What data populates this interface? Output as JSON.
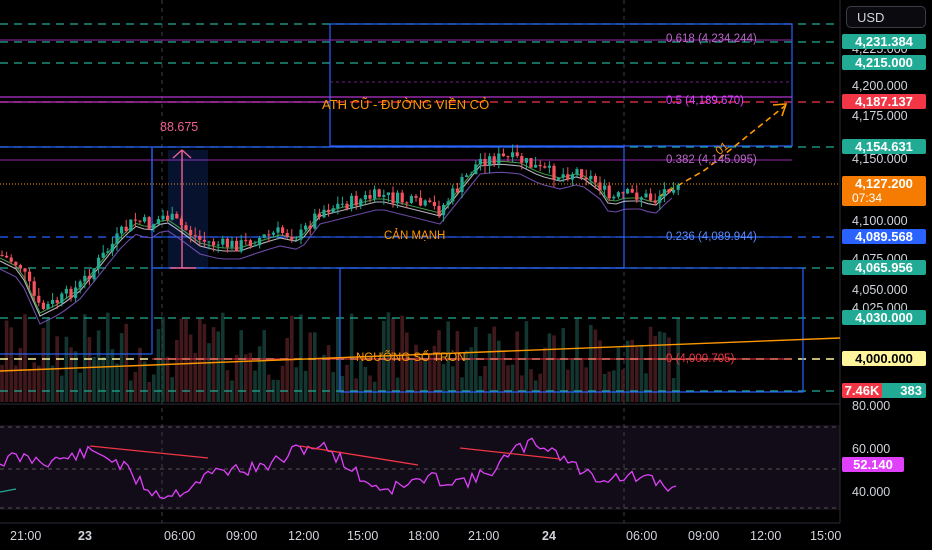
{
  "currency_label": "USD",
  "annotations": {
    "ath_label": "ATH CŨ - ĐƯỜNG VIỀN CỎ",
    "support_label": "CẢN MẠNH",
    "round_label": "NGƯỠNG SỐ TRÒN",
    "range_value": "88.675",
    "wave_label": "01"
  },
  "fib": {
    "f618": "0.618 (4,234.244)",
    "f5": "0.5 (4,189.670)",
    "f382": "0.382 (4,145.095)",
    "f236": "0.236 (4,089.944)",
    "f0": "0 (4,000.705)"
  },
  "price_axis": {
    "ticks": [
      "4,225.000",
      "4,200.000",
      "4,175.000",
      "4,150.000",
      "4,100.000",
      "4,075.000",
      "4,050.000",
      "4,025.000",
      "80.000",
      "60.000",
      "40.000"
    ]
  },
  "price_tags": {
    "t4231": "4,231.384",
    "t4215": "4,215.000",
    "t4187": "4,187.137",
    "t4154": "4,154.631",
    "current_price": "4,127.200",
    "countdown": "07:34",
    "t4089": "4,089.568",
    "t4065": "4,065.956",
    "t4030": "4,030.000",
    "t4000": "4,000.000",
    "volume": "7.46K",
    "hidden_value": "383",
    "rsi": "52.140"
  },
  "time_axis": [
    "21:00",
    "23",
    "06:00",
    "09:00",
    "12:00",
    "15:00",
    "18:00",
    "21:00",
    "24",
    "06:00",
    "09:00",
    "12:00",
    "15:00"
  ],
  "colors": {
    "up": "#22ab94",
    "down": "#f7525f",
    "fib": "#9c27b0",
    "blue_box": "#2962ff",
    "orange": "#ff9800",
    "teal_dash": "#22ab94",
    "pink": "#f23645",
    "rsi_line": "#e040fb"
  }
}
